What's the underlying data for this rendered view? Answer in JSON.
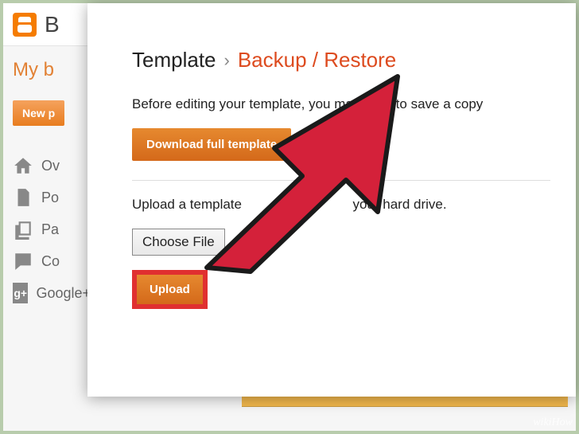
{
  "brand_letter": "B",
  "sidebar": {
    "title": "My b",
    "new_post": "New p",
    "items": [
      {
        "label": "Ov"
      },
      {
        "label": "Po"
      },
      {
        "label": "Pa"
      },
      {
        "label": "Co"
      },
      {
        "label": "Google+"
      }
    ]
  },
  "modal": {
    "bc_template": "Template",
    "bc_sep": "›",
    "bc_backup": "Backup / Restore",
    "info1": "Before editing your template, you may want to save a copy",
    "download": "Download full template",
    "info2_a": "Upload a template",
    "info2_b": "your hard drive.",
    "choose_file": "Choose File",
    "upload": "Upload"
  },
  "watermark": "wikiHow"
}
